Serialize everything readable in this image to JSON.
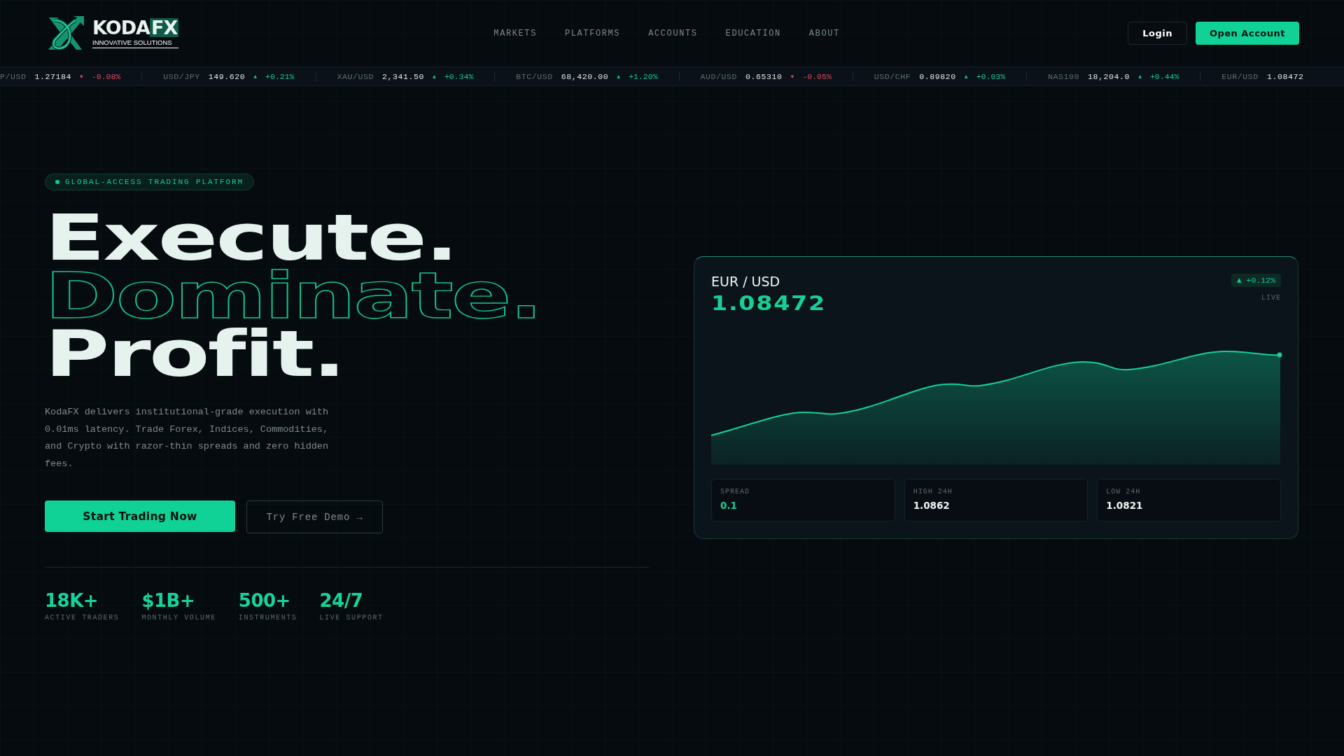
{
  "header": {
    "logo": {
      "word_1": "KODA",
      "word_2": "FX",
      "tagline": "INNOVATIVE SOLUTIONS"
    },
    "nav": [
      {
        "label": "MARKETS"
      },
      {
        "label": "PLATFORMS"
      },
      {
        "label": "ACCOUNTS"
      },
      {
        "label": "EDUCATION"
      },
      {
        "label": "ABOUT"
      }
    ],
    "login": "Login",
    "open_account": "Open Account"
  },
  "ticker": [
    {
      "pair": "P/USD",
      "price": "1.27184",
      "arrow": "▼",
      "change": "-0.08%",
      "rising": false
    },
    {
      "pair": "USD/JPY",
      "price": "149.620",
      "arrow": "▲",
      "change": "+0.21%",
      "rising": true
    },
    {
      "pair": "XAU/USD",
      "price": "2,341.50",
      "arrow": "▲",
      "change": "+0.34%",
      "rising": true
    },
    {
      "pair": "BTC/USD",
      "price": "68,420.00",
      "arrow": "▲",
      "change": "+1.20%",
      "rising": true
    },
    {
      "pair": "AUD/USD",
      "price": "0.65310",
      "arrow": "▼",
      "change": "-0.05%",
      "rising": false
    },
    {
      "pair": "USD/CHF",
      "price": "0.89820",
      "arrow": "▲",
      "change": "+0.03%",
      "rising": true
    },
    {
      "pair": "NAS100",
      "price": "18,204.0",
      "arrow": "▲",
      "change": "+0.44%",
      "rising": true
    },
    {
      "pair": "EUR/USD",
      "price": "1.08472"
    }
  ],
  "hero": {
    "badge": "GLOBAL-ACCESS TRADING PLATFORM",
    "headline": [
      {
        "text": "Execute.",
        "kind": "solid"
      },
      {
        "text": "Dominate.",
        "kind": "outline"
      },
      {
        "text": "Profit.",
        "kind": "solid"
      }
    ],
    "description": "KodaFX delivers institutional-grade execution with 0.01ms latency. Trade Forex, Indices, Commodities, and Crypto with razor-thin spreads and zero hidden fees.",
    "primary_button": "Start Trading Now",
    "secondary_button": "Try Free Demo →",
    "stats": [
      {
        "value": "18K+",
        "label": "ACTIVE TRADERS"
      },
      {
        "value": "$1B+",
        "label": "MONTHLY VOLUME"
      },
      {
        "value": "500+",
        "label": "INSTRUMENTS"
      },
      {
        "value": "24/7",
        "label": "LIVE SUPPORT"
      }
    ]
  },
  "quote_card": {
    "pair": "EUR / USD",
    "price": "1.08472",
    "change": "▲ +0.12%",
    "status": "LIVE",
    "stats": [
      {
        "label": "SPREAD",
        "value": "0.1",
        "highlight": true
      },
      {
        "label": "HIGH 24H",
        "value": "1.0862",
        "highlight": false
      },
      {
        "label": "LOW 24H",
        "value": "1.0821",
        "highlight": false
      }
    ]
  }
}
